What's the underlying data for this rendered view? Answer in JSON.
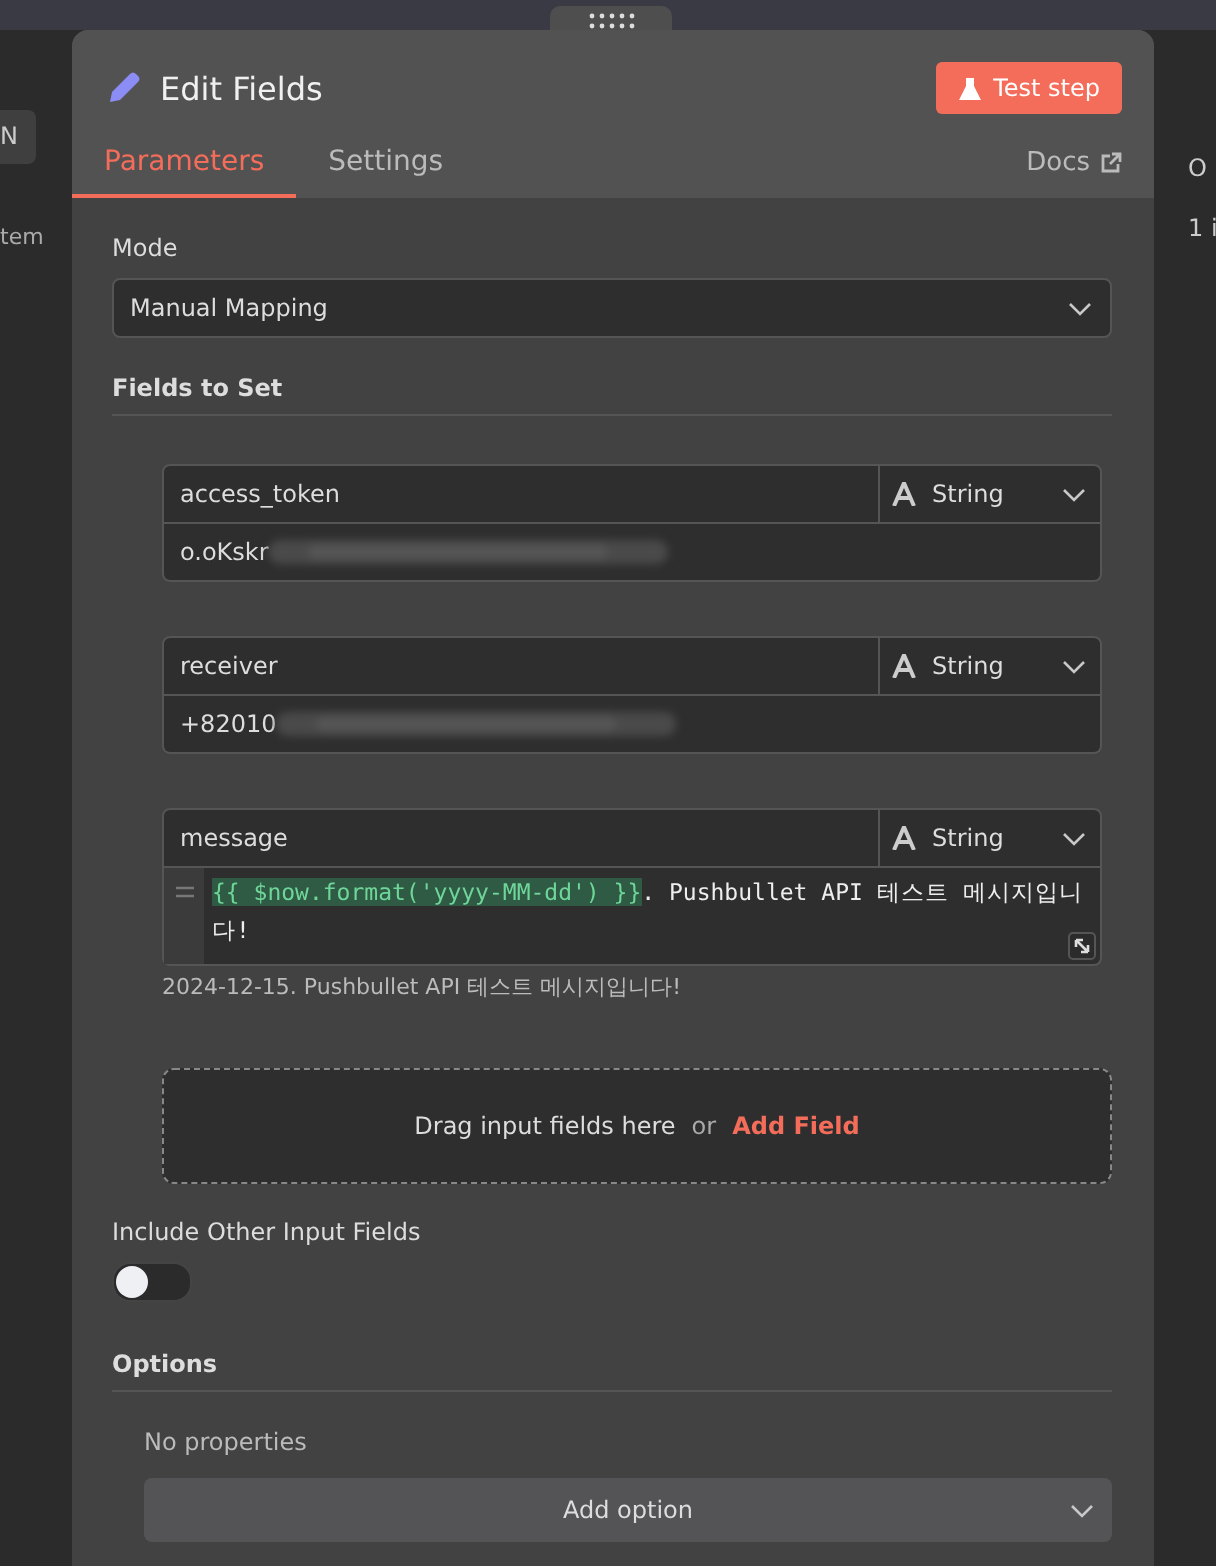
{
  "background": {
    "left_button": "N",
    "left_text": "tem",
    "right_texts": [
      "O",
      "1 i"
    ]
  },
  "panel": {
    "title": "Edit Fields",
    "test_button": "Test step",
    "tabs": [
      {
        "label": "Parameters",
        "selected": true
      },
      {
        "label": "Settings",
        "selected": false
      }
    ],
    "docs_link": "Docs",
    "mode": {
      "label": "Mode",
      "value": "Manual Mapping"
    },
    "fields_section": "Fields to Set",
    "fields": [
      {
        "kind": "plain",
        "name": "access_token",
        "type": "String",
        "value": "o.oKskr",
        "redacted": true
      },
      {
        "kind": "plain",
        "name": "receiver",
        "type": "String",
        "value": "+82010",
        "redacted": true
      },
      {
        "kind": "expression",
        "name": "message",
        "type": "String",
        "expression": "{{ $now.format('yyyy-MM-dd') }}",
        "value": ". Pushbullet API 테스트 메시지입니다!",
        "preview": "2024-12-15. Pushbullet API 테스트 메시지입니다!"
      }
    ],
    "drop_zone": {
      "text": "Drag input fields here",
      "or": "or",
      "link": "Add Field"
    },
    "include_other": {
      "label": "Include Other Input Fields",
      "on": false
    },
    "options": {
      "title": "Options",
      "empty": "No properties",
      "button": "Add option"
    }
  }
}
